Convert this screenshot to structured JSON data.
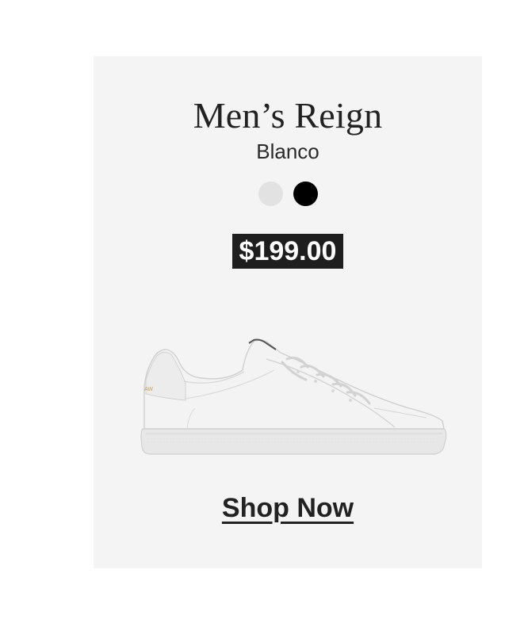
{
  "product": {
    "name": "Men’s Reign",
    "color_name": "Blanco",
    "price": "$199.00",
    "swatches": [
      {
        "name": "white",
        "color": "#e2e2e2"
      },
      {
        "name": "black",
        "color": "#000000"
      }
    ],
    "image_icon": "white-leather-sneaker"
  },
  "cta": {
    "label": "Shop Now"
  },
  "colors": {
    "card_background": "#f4f4f4",
    "price_background": "#1e1e1e",
    "price_text": "#ffffff",
    "text": "#222222"
  }
}
